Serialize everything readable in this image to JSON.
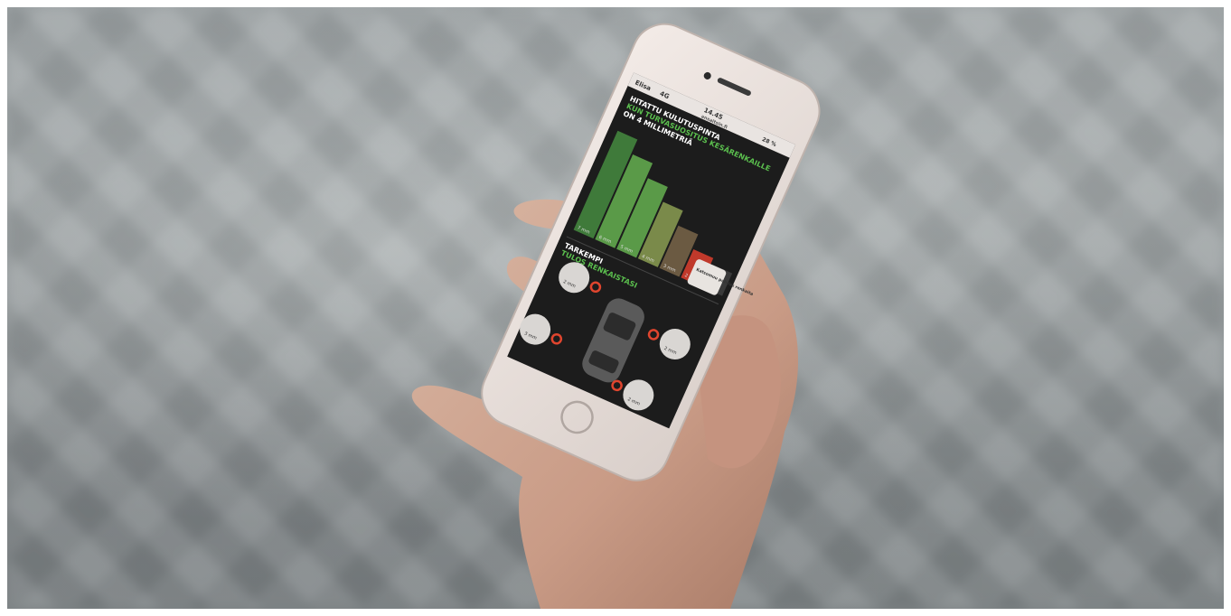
{
  "status_bar": {
    "carrier": "Elisa",
    "network": "4G",
    "time": "14.45",
    "battery": "28 %",
    "url": "ansaitsin.fi"
  },
  "chart_section": {
    "title_line1": "HITATTU KULUTUSPINTA",
    "title_line2": "KUN TURVASUOSITUS KESÄRENKAILLE",
    "title_line3": "ON 4 MILLIMETRIÄ",
    "bar_labels": [
      "7 mm",
      "6 mm",
      "5 mm",
      "4 mm",
      "3 mm",
      "2 mm",
      "1,6"
    ],
    "tooltip": "Katsomuu puhdas renkaita"
  },
  "tire_section": {
    "title_line1": "TARKEMPI",
    "title_line2": "TULOS RENKAISTASI",
    "tire_labels": [
      "2 mm",
      "3 mm",
      "2 mm",
      "2 mm"
    ]
  },
  "chart_data": {
    "type": "bar",
    "categories": [
      "7 mm",
      "6 mm",
      "5 mm",
      "4 mm",
      "3 mm",
      "2 mm",
      "1,6"
    ],
    "values": [
      7,
      6,
      5,
      4,
      3,
      2,
      1.6
    ]
  },
  "colors": {
    "bar_green_dark": "#3f7a3a",
    "bar_green": "#5a9a48",
    "bar_olive": "#7a8a4a",
    "bar_brown": "#6b5a42",
    "bar_red": "#c0392b",
    "accent_green": "#5bbf4e",
    "accent_red": "#e0452e"
  }
}
